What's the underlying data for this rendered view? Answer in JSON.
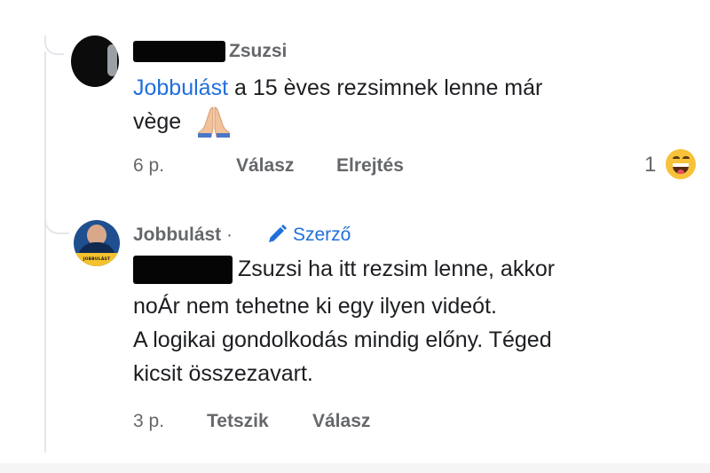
{
  "comment1": {
    "author_visible": "Zsuzsi",
    "mention": "Jobbulást",
    "text_line1_rest": " a 15 èves rezsimnek lenne már",
    "text_line2": "vège",
    "emoji": "folded-hands-emoji",
    "time": "6 p.",
    "reply_label": "Válasz",
    "hide_label": "Elrejtés",
    "reaction_count": "1",
    "reaction_icon": "laughing-emoji"
  },
  "comment2": {
    "author": "Jobbulást",
    "separator": "·",
    "badge_label": "Szerző",
    "badge_icon": "pen-icon",
    "avatar_badge_text": "JOBBULÁST",
    "text_line1_rest": "Zsuzsi ha itt rezsim lenne, akkor",
    "text_line2": "noÁr nem tehetne ki egy ilyen videót.",
    "text_line3": "A logikai gondolkodás mindig előny. Téged",
    "text_line4": "kicsit összezavart.",
    "time": "3 p.",
    "like_label": "Tetszik",
    "reply_label": "Válasz"
  },
  "colors": {
    "link": "#216fdb",
    "meta": "#65676b",
    "text": "#1c1e21",
    "thread_line": "#e4e6eb"
  }
}
